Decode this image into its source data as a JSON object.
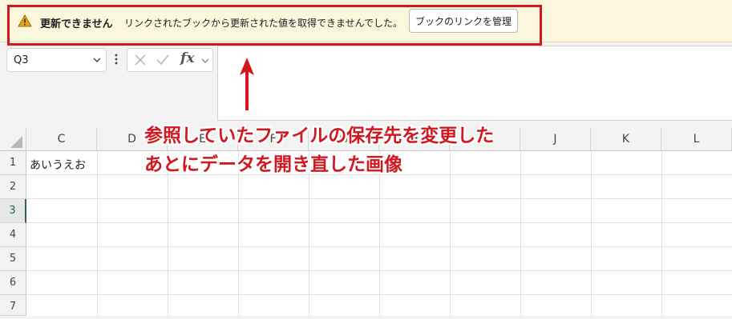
{
  "message_bar": {
    "title": "更新できません",
    "text": "リンクされたブックから更新された値を取得できませんでした。",
    "button_label": "ブックのリンクを管理"
  },
  "formula_bar": {
    "name_box": "Q3",
    "fx_label": "fx",
    "formula": ""
  },
  "grid": {
    "columns": [
      "C",
      "D",
      "E",
      "F",
      "G",
      "H",
      "I",
      "J",
      "K",
      "L"
    ],
    "rows": [
      "1",
      "2",
      "3",
      "4",
      "5",
      "6",
      "7"
    ],
    "active_row": "3",
    "cells": {
      "C1": "あいうえお"
    }
  },
  "annotation": {
    "line1": "参照していたファイルの保存先を変更した",
    "line2": "あとにデータを開き直した画像"
  },
  "colors": {
    "warning_bg": "#fbf7dc",
    "highlight_red": "#d4171d",
    "annotation_text": "#d01820",
    "active_row_accent": "#1e7145"
  },
  "icons": [
    "warning-icon",
    "chevron-down-icon",
    "more-vertical-icon",
    "cancel-icon",
    "enter-icon",
    "insert-function-icon",
    "arrow-up-icon"
  ]
}
